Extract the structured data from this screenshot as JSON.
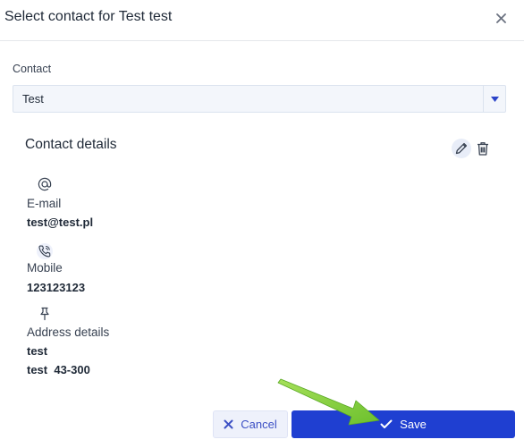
{
  "dialog": {
    "title": "Select contact for Test test",
    "close_icon": "close-icon"
  },
  "contact_field": {
    "label": "Contact",
    "value": "Test",
    "dropdown_icon": "caret-down-icon"
  },
  "contact_details": {
    "title": "Contact details",
    "edit_icon": "pencil-icon",
    "delete_icon": "trash-icon",
    "email": {
      "icon": "at-icon",
      "label": "E-mail",
      "value": "test@test.pl"
    },
    "mobile": {
      "icon": "phone-icon",
      "label": "Mobile",
      "value": "123123123"
    },
    "address": {
      "icon": "pin-icon",
      "label": "Address details",
      "line1": "test",
      "line2": "test  43-300"
    }
  },
  "footer": {
    "cancel_label": "Cancel",
    "save_label": "Save"
  },
  "colors": {
    "primary": "#1f3fd1",
    "cancel_bg": "#eef1fb",
    "annotation_arrow": "#7cc93a"
  }
}
